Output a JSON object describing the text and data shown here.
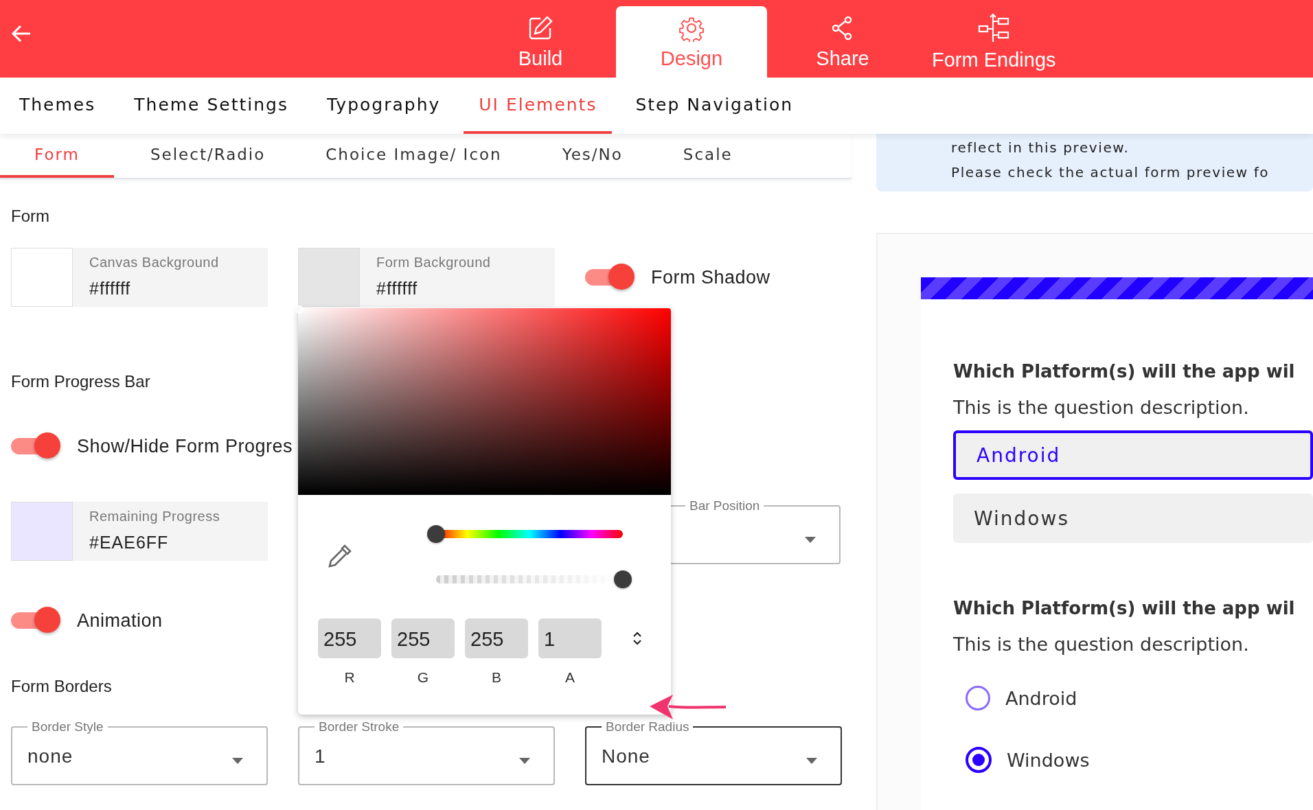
{
  "top_tabs": [
    {
      "label": "Build",
      "selected": false
    },
    {
      "label": "Design",
      "selected": true
    },
    {
      "label": "Share",
      "selected": false
    },
    {
      "label": "Form Endings",
      "selected": false
    }
  ],
  "sub_tabs": [
    {
      "label": "Themes",
      "selected": false
    },
    {
      "label": "Theme Settings",
      "selected": false
    },
    {
      "label": "Typography",
      "selected": false
    },
    {
      "label": "UI Elements",
      "selected": true
    },
    {
      "label": "Step Navigation",
      "selected": false
    }
  ],
  "element_tabs": [
    {
      "label": "Form",
      "selected": true
    },
    {
      "label": "Select/Radio",
      "selected": false
    },
    {
      "label": "Choice Image/ Icon",
      "selected": false
    },
    {
      "label": "Yes/No",
      "selected": false
    },
    {
      "label": "Scale",
      "selected": false
    }
  ],
  "info": [
    "reflect in this preview.",
    "Please check the actual form preview fo"
  ],
  "form": {
    "heading": "Form",
    "colors": [
      {
        "label": "Canvas Background",
        "value": "#ffffff",
        "active": false
      },
      {
        "label": "Form Background",
        "value": "#ffffff",
        "active": true
      }
    ],
    "shadow": {
      "label": "Form Shadow",
      "on": true
    }
  },
  "progress": {
    "heading": "Form Progress Bar",
    "toggle": {
      "label": "Show/Hide Form Progres",
      "on": true
    },
    "color": {
      "label": "Remaining Progress",
      "value": "#EAE6FF",
      "active": false
    },
    "position": {
      "label": "Bar Position"
    },
    "animation": {
      "label": "Animation",
      "on": true
    }
  },
  "borders": {
    "heading": "Form Borders",
    "selects": [
      {
        "label": "Border Style",
        "value": "none",
        "focused": false
      },
      {
        "label": "Border Stroke",
        "value": "1",
        "focused": false
      },
      {
        "label": "Border Radius",
        "value": "None",
        "focused": true
      }
    ]
  },
  "picker": {
    "hue": {
      "level": 0
    },
    "alpha": {
      "level": 1
    },
    "channels": [
      {
        "label": "R",
        "value": "255"
      },
      {
        "label": "G",
        "value": "255"
      },
      {
        "label": "B",
        "value": "255"
      },
      {
        "label": "A",
        "value": "1"
      }
    ]
  },
  "preview": {
    "progress": {
      "level": 1
    },
    "questions": [
      {
        "kind": "select",
        "title": "Which Platform(s) will the app wil",
        "description": "This is the question description.",
        "options": [
          {
            "label": "Android",
            "selected": true
          },
          {
            "label": "Windows",
            "selected": false
          }
        ]
      },
      {
        "kind": "radio",
        "title": "Which Platform(s) will the app wil",
        "description": "This is the question description.",
        "options": [
          {
            "label": "Android",
            "selected": false
          },
          {
            "label": "Windows",
            "selected": true
          }
        ]
      }
    ]
  }
}
